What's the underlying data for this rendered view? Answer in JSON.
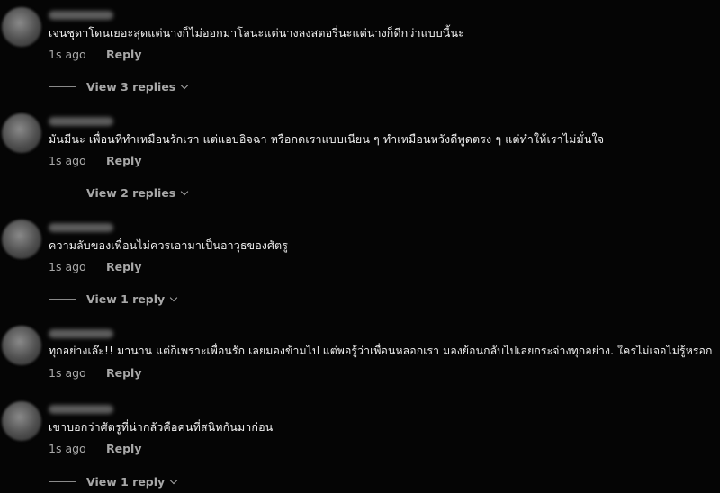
{
  "comments": [
    {
      "text": "เจนชุดาโดนเยอะสุดแต่นางก็ไม่ออกมาโลนะแต่นางลงสตอรี่นะแต่นางก็ดีกว่าแบบนี้นะ",
      "time": "1s ago",
      "reply_label": "Reply",
      "view_replies": "View 3 replies"
    },
    {
      "text": "มันมีนะ เพื่อนที่ทำเหมือนรักเรา แต่แอบอิจฉา หรือกดเราแบบเนียน ๆ ทำเหมือนหวังดีพูดตรง ๆ แต่ทำให้เราไม่มั่นใจ",
      "time": "1s ago",
      "reply_label": "Reply",
      "view_replies": "View 2 replies"
    },
    {
      "text": "ความลับของเพื่อนไม่ควรเอามาเป็นอาวุธของศัตรู",
      "time": "1s ago",
      "reply_label": "Reply",
      "view_replies": "View 1 reply"
    },
    {
      "text": "ทุกอย่างเล๊ะ!! มานาน แต่ก็เพราะเพื่อนรัก เลยมองข้ามไป แต่พอรู้ว่าเพื่อนหลอกเรา มองย้อนกลับไปเลยกระจ่างทุกอย่าง. ใครไม่เจอไม่รู้หรอก",
      "time": "1s ago",
      "reply_label": "Reply",
      "view_replies": ""
    },
    {
      "text": "เขาบอกว่าศัตรูที่น่ากลัวคือคนที่สนิทกันมาก่อน",
      "time": "1s ago",
      "reply_label": "Reply",
      "view_replies": "View 1 reply"
    }
  ],
  "colors": {
    "background": "#050505",
    "text": "#f1f1f1",
    "muted": "#a8a8a8"
  }
}
